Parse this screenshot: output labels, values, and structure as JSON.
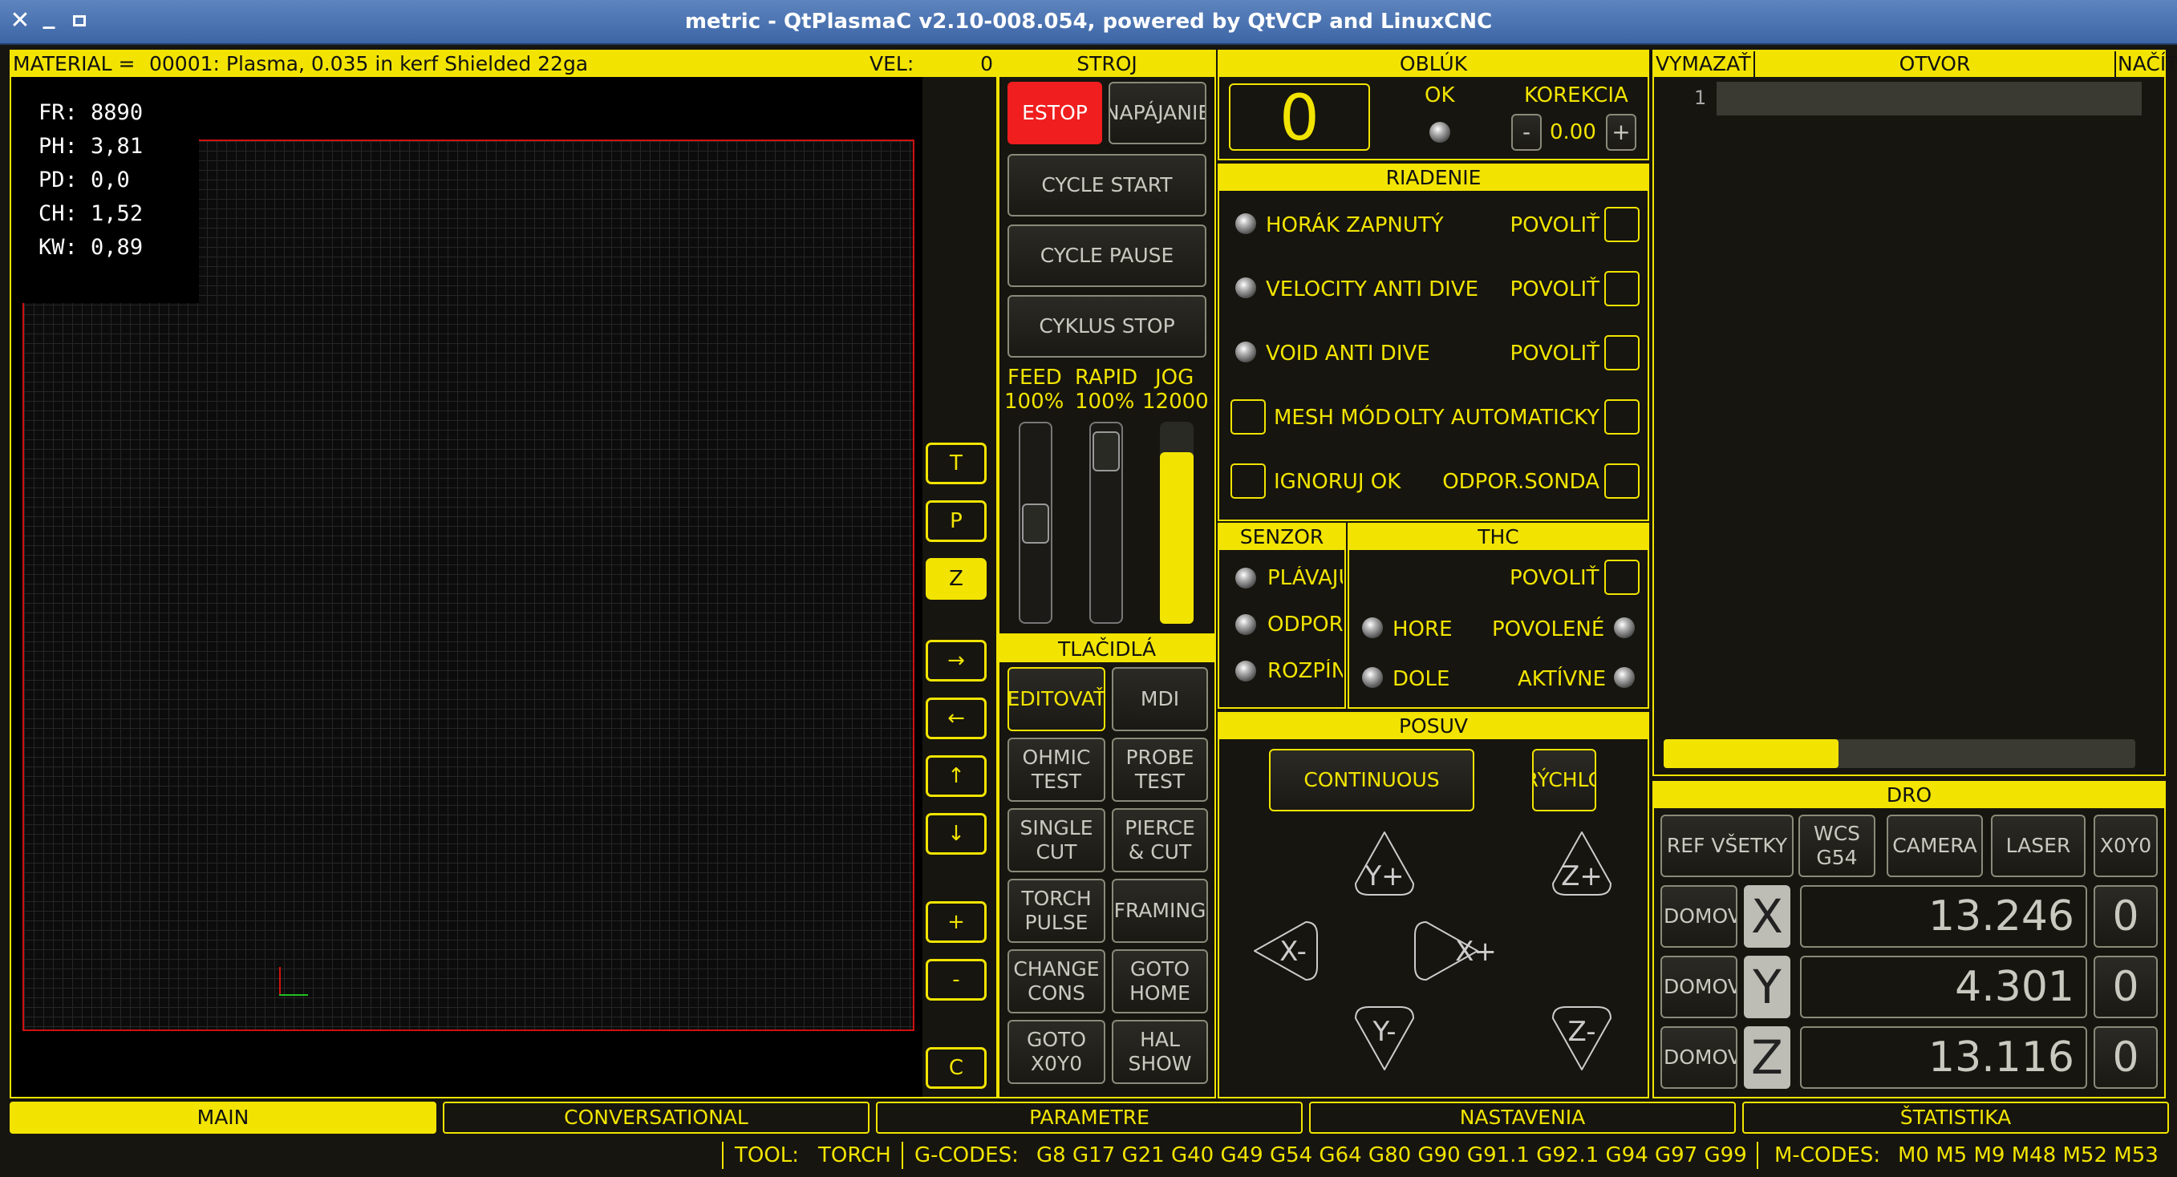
{
  "window": {
    "title": "metric - QtPlasmaC v2.10-008.054, powered by QtVCP and LinuxCNC"
  },
  "colors": {
    "accent": "#f2e400",
    "estop": "#f01e1e",
    "panel_bg": "#16150f",
    "preview_border": "#d01010"
  },
  "preview": {
    "material_label": "MATERIAL =",
    "material_value": "00001: Plasma, 0.035 in kerf Shielded 22ga",
    "vel_label": "VEL:",
    "vel_value": "0",
    "stats": [
      {
        "k": "FR:",
        "v": "8890"
      },
      {
        "k": "PH:",
        "v": "3,81"
      },
      {
        "k": "PD:",
        "v": "0,0"
      },
      {
        "k": "CH:",
        "v": "1,52"
      },
      {
        "k": "KW:",
        "v": "0,89"
      }
    ]
  },
  "view_buttons": [
    "T",
    "P",
    "Z",
    "→",
    "←",
    "↑",
    "↓",
    "+",
    "-",
    "C"
  ],
  "machine": {
    "header": "STROJ",
    "estop": "ESTOP",
    "power": "NAPÁJANIE",
    "cycle_start": "CYCLE START",
    "cycle_pause": "CYCLE PAUSE",
    "cycle_stop": "CYKLUS STOP",
    "feed_label": "FEED",
    "feed_value": "100%",
    "rapid_label": "RAPID",
    "rapid_value": "100%",
    "jog_label": "JOG",
    "jog_value": "12000",
    "feed_level": 0.5,
    "rapid_level": 1.0,
    "jog_level": 0.85
  },
  "buttons": {
    "header": "TLAČIDLÁ",
    "items": [
      [
        "EDITOVAŤ",
        "MDI"
      ],
      [
        "OHMIC\nTEST",
        "PROBE\nTEST"
      ],
      [
        "SINGLE\nCUT",
        "PIERCE\n& CUT"
      ],
      [
        "TORCH\nPULSE",
        "FRAMING"
      ],
      [
        "CHANGE\nCONS",
        "GOTO\nHOME"
      ],
      [
        "GOTO\nX0Y0",
        "HAL\nSHOW"
      ]
    ]
  },
  "arc": {
    "header": "OBLÚK",
    "voltage": "0",
    "ok_label": "OK",
    "correction_label": "KOREKCIA",
    "minus": "-",
    "correction_value": "0.00",
    "plus": "+"
  },
  "control": {
    "header": "RIADENIE",
    "rows": [
      {
        "label": "HORÁK ZAPNUTÝ",
        "right": "POVOLIŤ"
      },
      {
        "label": "VELOCITY ANTI DIVE",
        "right": "POVOLIŤ"
      },
      {
        "label": "VOID ANTI DIVE",
        "right": "POVOLIŤ"
      },
      {
        "label": "MESH MÓD",
        "right": "OLTY AUTOMATICKY"
      },
      {
        "label": "IGNORUJ OK",
        "right": "ODPOR.SONDA"
      }
    ]
  },
  "sensor": {
    "header": "SENZOR",
    "items": [
      "PLÁVAJÚ",
      "ODPOR",
      "ROZPÍN"
    ]
  },
  "thc": {
    "header": "THC",
    "enable": "POVOLIŤ",
    "up": "HORE",
    "down": "DOLE",
    "enabled": "POVOLENÉ",
    "active": "AKTÍVNE"
  },
  "jog": {
    "header": "POSUV",
    "mode": "CONTINUOUS",
    "speed": "RÝCHLO",
    "yplus": "Y+",
    "yminus": "Y-",
    "xplus": "X+",
    "xminus": "X-",
    "zplus": "Z+",
    "zminus": "Z-"
  },
  "gcode": {
    "clear": "VYMAZAŤ",
    "open": "OTVOR",
    "load": "NAČÍTAŤ",
    "line_number": "1",
    "progress": 0.37
  },
  "dro": {
    "header": "DRO",
    "ref_all": "REF VŠETKY",
    "wcs": "WCS\nG54",
    "camera": "CAMERA",
    "laser": "LASER",
    "x0y0": "X0Y0",
    "axes": [
      {
        "home": "DOMOV",
        "axis": "X",
        "value": "13.246",
        "zero": "0"
      },
      {
        "home": "DOMOV",
        "axis": "Y",
        "value": "4.301",
        "zero": "0"
      },
      {
        "home": "DOMOV",
        "axis": "Z",
        "value": "13.116",
        "zero": "0"
      }
    ]
  },
  "tabs": [
    "MAIN",
    "CONVERSATIONAL",
    "PARAMETRE",
    "NASTAVENIA",
    "ŠTATISTIKA"
  ],
  "status": {
    "tool_label": "TOOL:",
    "tool_value": "TORCH",
    "gcodes_label": "G-CODES:",
    "gcodes_value": "G8 G17 G21 G40 G49 G54 G64 G80 G90 G91.1 G92.1 G94 G97 G99",
    "mcodes_label": "M-CODES:",
    "mcodes_value": "M0 M5 M9 M48 M52 M53"
  }
}
